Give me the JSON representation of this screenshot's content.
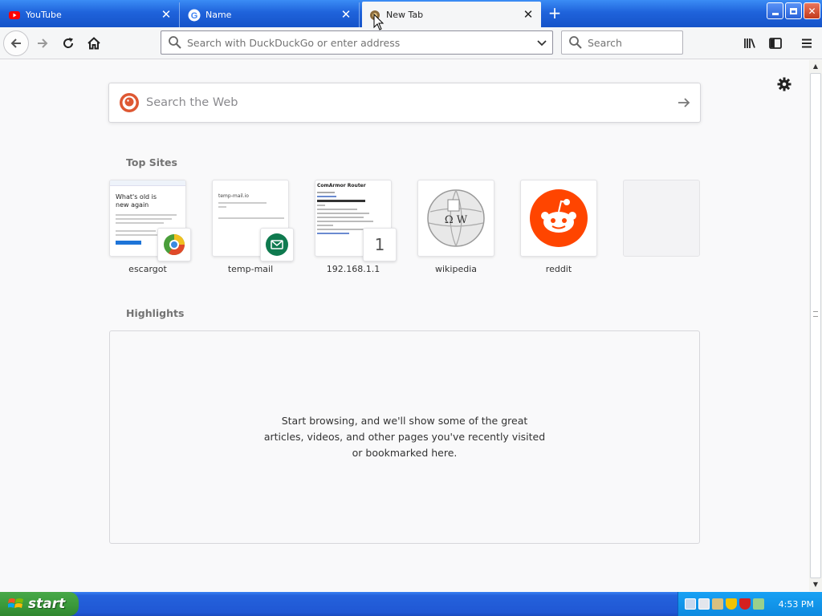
{
  "tabs": [
    {
      "label": "YouTube",
      "icon": "youtube-icon",
      "active": false
    },
    {
      "label": "Name",
      "icon": "google-icon",
      "active": false
    },
    {
      "label": "New Tab",
      "icon": "newtab-icon",
      "active": true
    }
  ],
  "toolbar": {
    "url_placeholder": "Search with DuckDuckGo or enter address",
    "search_placeholder": "Search"
  },
  "newtab": {
    "web_search_placeholder": "Search the Web",
    "top_sites_title": "Top Sites",
    "top_sites": [
      {
        "label": "escargot",
        "thumb": {
          "title": "What's old is new again"
        }
      },
      {
        "label": "temp-mail",
        "thumb": {
          "title": "temp-mail.io"
        }
      },
      {
        "label": "192.168.1.1",
        "thumb": {
          "title": "ComArmor Router"
        },
        "badge": "1"
      },
      {
        "label": "wikipedia",
        "thumb": {
          "letters": "Ω W"
        }
      },
      {
        "label": "reddit"
      }
    ],
    "highlights_title": "Highlights",
    "highlights_message": "Start browsing, and we'll show some of the great articles, videos, and other pages you've recently visited or bookmarked here."
  },
  "taskbar": {
    "start_label": "start",
    "clock": "4:53 PM"
  },
  "colors": {
    "xp_blue": "#2057d4",
    "start_green": "#3c9b3c",
    "reddit_orange": "#ff4500",
    "duckduckgo_orange": "#de5833"
  }
}
